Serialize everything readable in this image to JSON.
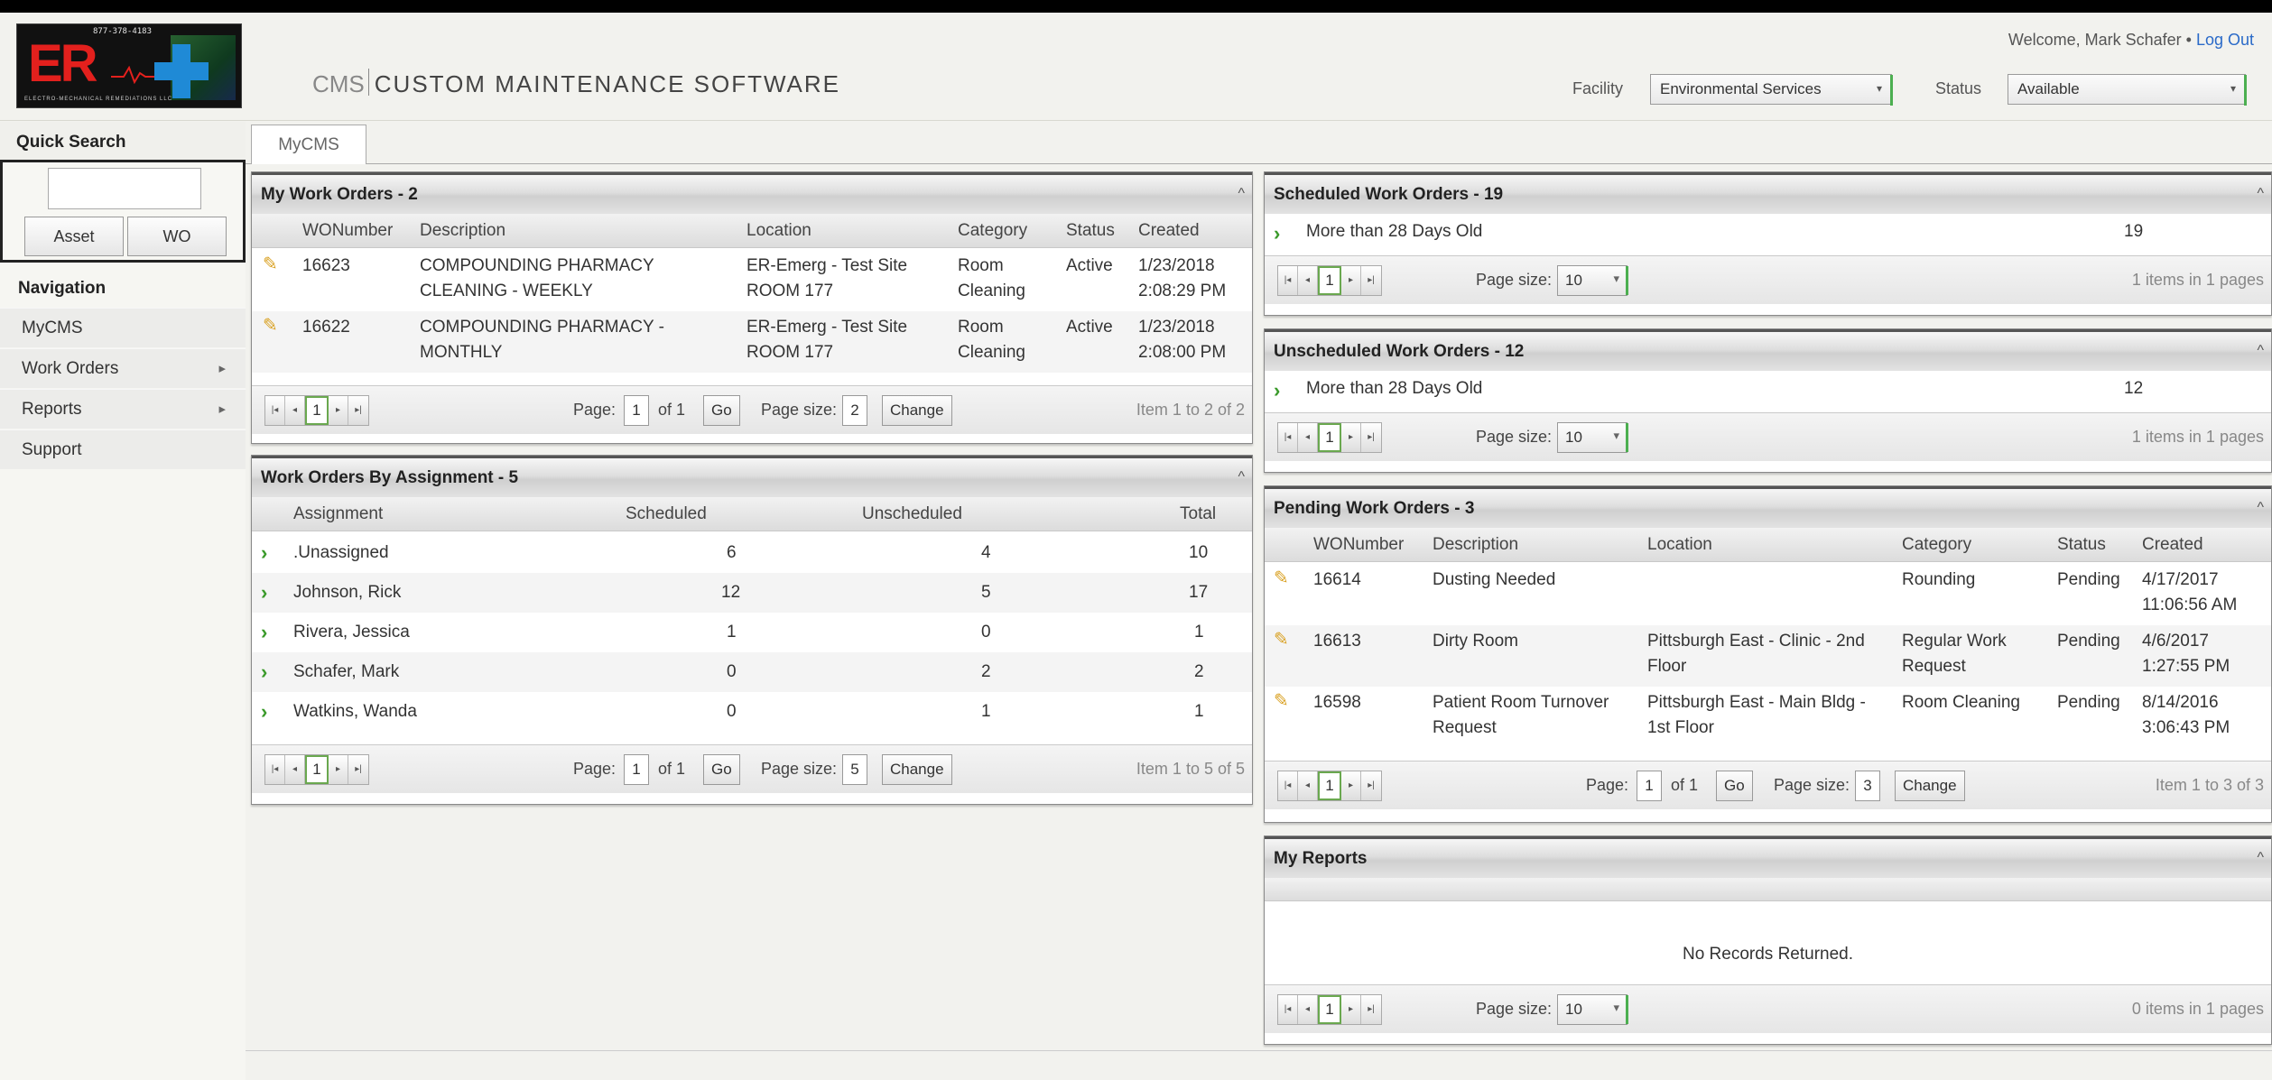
{
  "header": {
    "logo_phone": "877-378-4183",
    "logo_text": "ER",
    "logo_tagline": "ELECTRO-MECHANICAL REMEDIATIONS LLC",
    "brand_prefix": "CMS",
    "brand_title": "CUSTOM MAINTENANCE SOFTWARE",
    "welcome_text": "Welcome, Mark Schafer • ",
    "logout": "Log Out",
    "facility_label": "Facility",
    "facility_value": "Environmental Services",
    "status_label": "Status",
    "status_value": "Available"
  },
  "sidebar": {
    "quick_search_title": "Quick Search",
    "asset_button": "Asset",
    "wo_button": "WO",
    "navigation_title": "Navigation",
    "items": [
      {
        "label": "MyCMS"
      },
      {
        "label": "Work Orders"
      },
      {
        "label": "Reports"
      },
      {
        "label": "Support"
      }
    ]
  },
  "tabs": {
    "mycms": "MyCMS"
  },
  "my_work_orders": {
    "title": "My Work Orders - 2",
    "columns": [
      "WONumber",
      "Description",
      "Location",
      "Category",
      "Status",
      "Created"
    ],
    "rows": [
      {
        "wo": "16623",
        "desc1": "COMPOUNDING PHARMACY",
        "desc2": "CLEANING - WEEKLY",
        "loc1": "ER-Emerg - Test Site",
        "loc2": "ROOM 177",
        "cat1": "Room",
        "cat2": "Cleaning",
        "status": "Active",
        "created1": "1/23/2018",
        "created2": "2:08:29 PM"
      },
      {
        "wo": "16622",
        "desc1": "COMPOUNDING PHARMACY -",
        "desc2": "MONTHLY",
        "loc1": "ER-Emerg - Test Site",
        "loc2": "ROOM 177",
        "cat1": "Room",
        "cat2": "Cleaning",
        "status": "Active",
        "created1": "1/23/2018",
        "created2": "2:08:00 PM"
      }
    ],
    "pager": {
      "current": "1",
      "page_label": "Page:",
      "page_value": "1",
      "of": "of 1",
      "go": "Go",
      "size_label": "Page size:",
      "size_value": "2",
      "change": "Change",
      "info": "Item 1 to 2 of 2"
    }
  },
  "by_assignment": {
    "title": "Work Orders By Assignment - 5",
    "columns": [
      "Assignment",
      "Scheduled",
      "Unscheduled",
      "Total"
    ],
    "rows": [
      {
        "name": ".Unassigned",
        "scheduled": "6",
        "unscheduled": "4",
        "total": "10"
      },
      {
        "name": "Johnson, Rick",
        "scheduled": "12",
        "unscheduled": "5",
        "total": "17"
      },
      {
        "name": "Rivera, Jessica",
        "scheduled": "1",
        "unscheduled": "0",
        "total": "1"
      },
      {
        "name": "Schafer, Mark",
        "scheduled": "0",
        "unscheduled": "2",
        "total": "2"
      },
      {
        "name": "Watkins, Wanda",
        "scheduled": "0",
        "unscheduled": "1",
        "total": "1"
      }
    ],
    "pager": {
      "current": "1",
      "page_label": "Page:",
      "page_value": "1",
      "of": "of 1",
      "go": "Go",
      "size_label": "Page size:",
      "size_value": "5",
      "change": "Change",
      "info": "Item 1 to 5 of 5"
    }
  },
  "scheduled": {
    "title": "Scheduled Work Orders - 19",
    "row_label": "More than 28 Days Old",
    "row_count": "19",
    "pager": {
      "current": "1",
      "size_label": "Page size:",
      "size_value": "10",
      "info": "1 items in 1 pages"
    }
  },
  "unscheduled": {
    "title": "Unscheduled Work Orders - 12",
    "row_label": "More than 28 Days Old",
    "row_count": "12",
    "pager": {
      "current": "1",
      "size_label": "Page size:",
      "size_value": "10",
      "info": "1 items in 1 pages"
    }
  },
  "pending": {
    "title": "Pending Work Orders - 3",
    "columns": [
      "WONumber",
      "Description",
      "Location",
      "Category",
      "Status",
      "Created"
    ],
    "rows": [
      {
        "wo": "16614",
        "desc1": "Dusting Needed",
        "desc2": "",
        "loc1": "",
        "loc2": "",
        "cat1": "Rounding",
        "cat2": "",
        "status": "Pending",
        "created1": "4/17/2017",
        "created2": "11:06:56 AM"
      },
      {
        "wo": "16613",
        "desc1": "Dirty Room",
        "desc2": "",
        "loc1": "Pittsburgh East - Clinic - 2nd",
        "loc2": "Floor",
        "cat1": "Regular Work",
        "cat2": "Request",
        "status": "Pending",
        "created1": "4/6/2017",
        "created2": "1:27:55 PM"
      },
      {
        "wo": "16598",
        "desc1": "Patient Room Turnover",
        "desc2": "Request",
        "loc1": "Pittsburgh East - Main Bldg -",
        "loc2": "1st Floor",
        "cat1": "Room Cleaning",
        "cat2": "",
        "status": "Pending",
        "created1": "8/14/2016",
        "created2": "3:06:43 PM"
      }
    ],
    "pager": {
      "current": "1",
      "page_label": "Page:",
      "page_value": "1",
      "of": "of 1",
      "go": "Go",
      "size_label": "Page size:",
      "size_value": "3",
      "change": "Change",
      "info": "Item 1 to 3 of 3"
    }
  },
  "my_reports": {
    "title": "My Reports",
    "empty": "No Records Returned.",
    "pager": {
      "current": "1",
      "size_label": "Page size:",
      "size_value": "10",
      "info": "0 items in 1 pages"
    }
  }
}
